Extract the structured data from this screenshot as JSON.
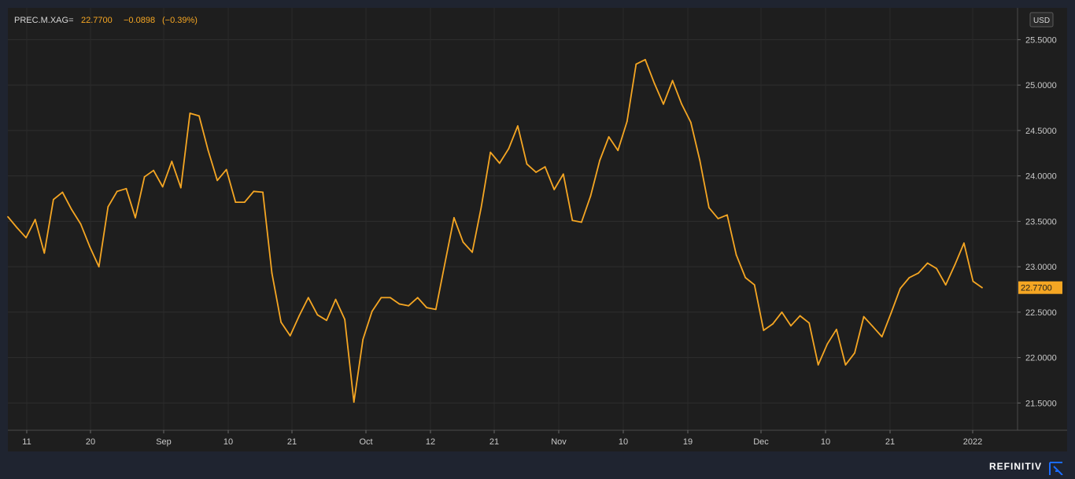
{
  "header": {
    "ric": "PREC.M.XAG=",
    "last": "22.7700",
    "change": "−0.0898",
    "change_pct": "(−0.39%)"
  },
  "currency_label": "USD",
  "last_price_tag": "22.7700",
  "brand": "REFINITIV",
  "colors": {
    "background": "#1e1e1e",
    "frame": "#1f2430",
    "line": "#f5a623",
    "grid": "#2e2e2e",
    "text": "#c9c9c9"
  },
  "chart_data": {
    "type": "line",
    "title": "",
    "xlabel": "",
    "ylabel": "",
    "ylim": [
      21.2,
      25.85
    ],
    "y_ticks": [
      "21.5000",
      "22.0000",
      "22.5000",
      "23.0000",
      "23.5000",
      "24.0000",
      "24.5000",
      "25.0000",
      "25.5000"
    ],
    "x_ticks": [
      "11",
      "20",
      "Sep",
      "10",
      "21",
      "Oct",
      "12",
      "21",
      "Nov",
      "10",
      "19",
      "Dec",
      "10",
      "21",
      "2022"
    ],
    "grid": true,
    "series": [
      {
        "values": [
          23.55,
          23.43,
          23.32,
          23.52,
          23.15,
          23.74,
          23.82,
          23.63,
          23.47,
          23.22,
          23.0,
          23.66,
          23.83,
          23.86,
          23.54,
          23.99,
          24.06,
          23.88,
          24.16,
          23.87,
          24.69,
          24.66,
          24.28,
          23.95,
          24.07,
          23.71,
          23.71,
          23.83,
          23.82,
          22.93,
          22.39,
          22.24,
          22.46,
          22.66,
          22.47,
          22.41,
          22.64,
          22.42,
          21.51,
          22.2,
          22.51,
          22.66,
          22.66,
          22.59,
          22.57,
          22.66,
          22.55,
          22.53,
          23.04,
          23.54,
          23.27,
          23.16,
          23.66,
          24.26,
          24.14,
          24.3,
          24.55,
          24.13,
          24.04,
          24.1,
          23.85,
          24.02,
          23.51,
          23.49,
          23.78,
          24.17,
          24.43,
          24.28,
          24.6,
          25.23,
          25.28,
          25.02,
          24.79,
          25.05,
          24.79,
          24.59,
          24.17,
          23.65,
          23.53,
          23.57,
          23.13,
          22.88,
          22.8,
          22.3,
          22.37,
          22.5,
          22.35,
          22.46,
          22.38,
          21.92,
          22.15,
          22.31,
          21.92,
          22.05,
          22.45,
          22.34,
          22.23,
          22.49,
          22.76,
          22.88,
          22.93,
          23.04,
          22.98,
          22.8,
          23.02,
          23.26,
          22.84,
          22.77
        ]
      }
    ]
  }
}
